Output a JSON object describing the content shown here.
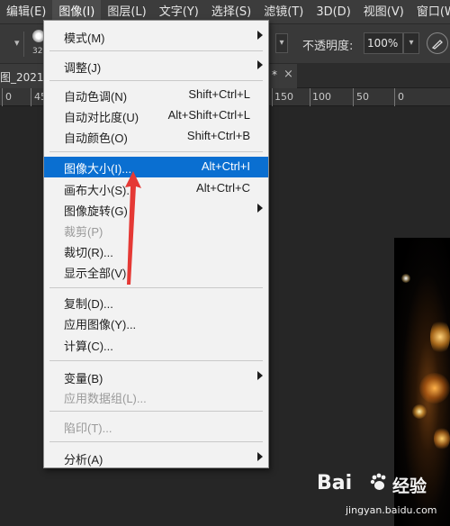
{
  "menubar": {
    "items": [
      "编辑(E)",
      "图像(I)",
      "图层(L)",
      "文字(Y)",
      "选择(S)",
      "滤镜(T)",
      "3D(D)",
      "视图(V)",
      "窗口(W)"
    ],
    "active_index": 1
  },
  "options": {
    "brush_size": "32",
    "opacity_label": "不透明度:",
    "opacity_value": "100%"
  },
  "document": {
    "tab_title_partial": "图_2021",
    "modified_mark": "*",
    "close_glyph": "×"
  },
  "ruler": {
    "ticks_left": [
      "0",
      "45"
    ],
    "ticks_right": [
      "150",
      "100",
      "50",
      "0"
    ]
  },
  "image_menu": {
    "items": [
      {
        "label": "模式(M)",
        "shortcut": "",
        "submenu": true,
        "disabled": false,
        "selected": false
      },
      {
        "label": "调整(J)",
        "shortcut": "",
        "submenu": true,
        "disabled": false,
        "selected": false
      },
      {
        "label": "自动色调(N)",
        "shortcut": "Shift+Ctrl+L",
        "submenu": false,
        "disabled": false,
        "selected": false
      },
      {
        "label": "自动对比度(U)",
        "shortcut": "Alt+Shift+Ctrl+L",
        "submenu": false,
        "disabled": false,
        "selected": false
      },
      {
        "label": "自动颜色(O)",
        "shortcut": "Shift+Ctrl+B",
        "submenu": false,
        "disabled": false,
        "selected": false
      },
      {
        "label": "图像大小(I)...",
        "shortcut": "Alt+Ctrl+I",
        "submenu": false,
        "disabled": false,
        "selected": true
      },
      {
        "label": "画布大小(S)...",
        "shortcut": "Alt+Ctrl+C",
        "submenu": false,
        "disabled": false,
        "selected": false
      },
      {
        "label": "图像旋转(G)",
        "shortcut": "",
        "submenu": true,
        "disabled": false,
        "selected": false
      },
      {
        "label": "裁剪(P)",
        "shortcut": "",
        "submenu": false,
        "disabled": true,
        "selected": false
      },
      {
        "label": "裁切(R)...",
        "shortcut": "",
        "submenu": false,
        "disabled": false,
        "selected": false
      },
      {
        "label": "显示全部(V)",
        "shortcut": "",
        "submenu": false,
        "disabled": false,
        "selected": false
      },
      {
        "label": "复制(D)...",
        "shortcut": "",
        "submenu": false,
        "disabled": false,
        "selected": false
      },
      {
        "label": "应用图像(Y)...",
        "shortcut": "",
        "submenu": false,
        "disabled": false,
        "selected": false
      },
      {
        "label": "计算(C)...",
        "shortcut": "",
        "submenu": false,
        "disabled": false,
        "selected": false
      },
      {
        "label": "变量(B)",
        "shortcut": "",
        "submenu": true,
        "disabled": false,
        "selected": false
      },
      {
        "label": "应用数据组(L)...",
        "shortcut": "",
        "submenu": false,
        "disabled": true,
        "selected": false
      },
      {
        "label": "陷印(T)...",
        "shortcut": "",
        "submenu": false,
        "disabled": true,
        "selected": false
      },
      {
        "label": "分析(A)",
        "shortcut": "",
        "submenu": true,
        "disabled": false,
        "selected": false
      }
    ]
  },
  "watermark": {
    "logo_text": "Bai",
    "brand": "经验",
    "url": "jingyan.baidu.com"
  },
  "colors": {
    "menu_highlight": "#0a6fd1",
    "annotation_arrow": "#e53935",
    "app_background": "#262626"
  }
}
